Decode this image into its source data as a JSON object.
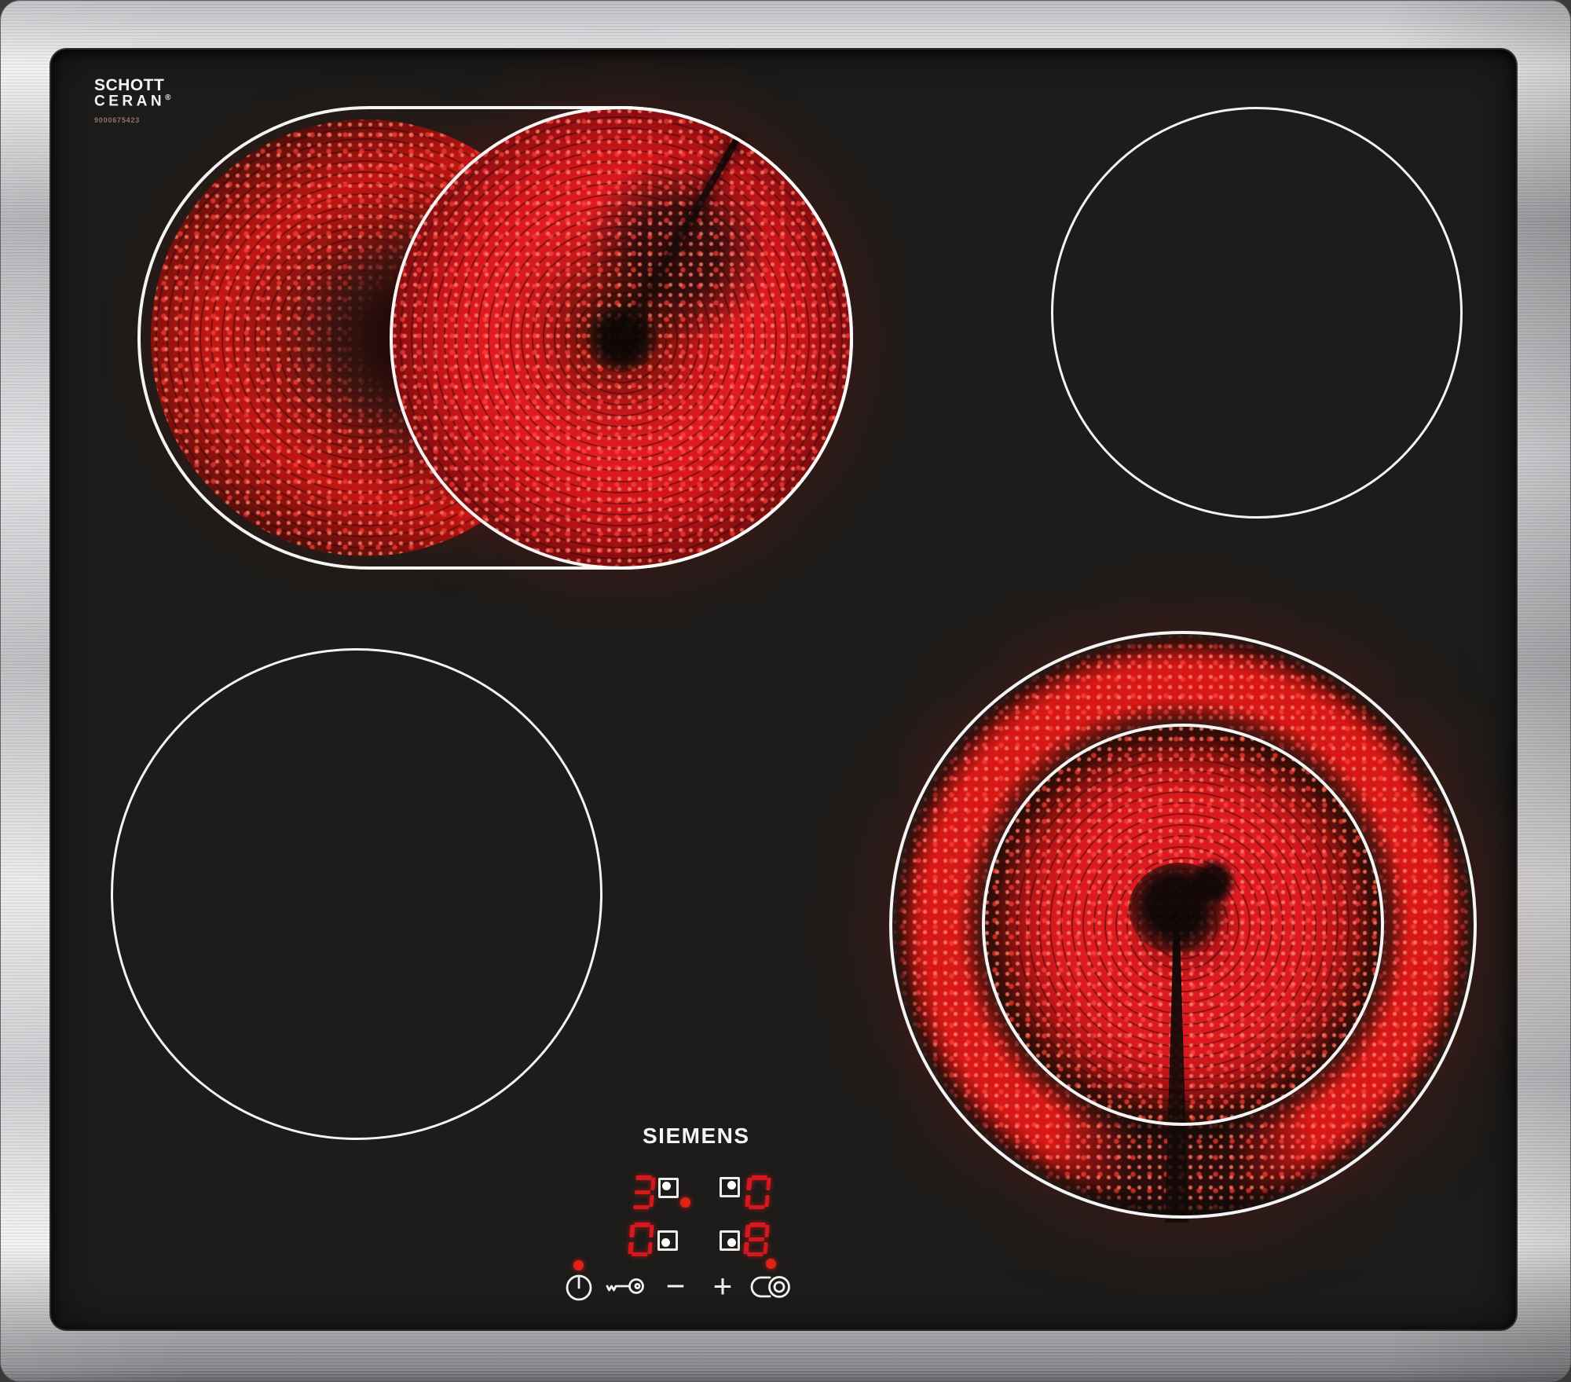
{
  "product": {
    "manufacturer_logo": "SIEMENS",
    "glass_brand_line1": "SCHOTT",
    "glass_brand_line2": "CERAN",
    "glass_brand_registered": "®",
    "part_number": "9000675423"
  },
  "cooking_zones": {
    "rear_left": {
      "name": "rear left oval dual-circuit zone",
      "state": "on",
      "heat_level": "3"
    },
    "rear_right": {
      "name": "rear right zone",
      "state": "off",
      "heat_level": "0"
    },
    "front_left": {
      "name": "front left zone",
      "state": "off",
      "heat_level": "0"
    },
    "front_right": {
      "name": "front right dual-ring zone",
      "state": "on",
      "heat_level": "8"
    }
  },
  "display": {
    "readouts": [
      {
        "zone": "rear_left",
        "level": "3",
        "indicator_corner": "top-left",
        "red_dot": true
      },
      {
        "zone": "rear_right",
        "level": "0",
        "indicator_corner": "top-right",
        "red_dot": false
      },
      {
        "zone": "front_left",
        "level": "0",
        "indicator_corner": "bottom-left",
        "red_dot": false
      },
      {
        "zone": "front_right",
        "level": "8",
        "indicator_corner": "bottom-right",
        "red_dot": true
      }
    ],
    "power_indicator_on": true
  },
  "controls": {
    "power": {
      "icon": "power-icon"
    },
    "child_lock": {
      "icon": "key-icon"
    },
    "decrease": {
      "label": "−"
    },
    "increase": {
      "label": "+"
    },
    "dual_zone": {
      "icon": "dual-zone-icon"
    }
  },
  "colors": {
    "glass": "#1d1c1a",
    "frame_steel": "#c9cacc",
    "zone_outline": "#ffffff",
    "segment_red": "#d5181f",
    "indicator_red": "#e32119",
    "glow_red": "#e01a1d"
  }
}
